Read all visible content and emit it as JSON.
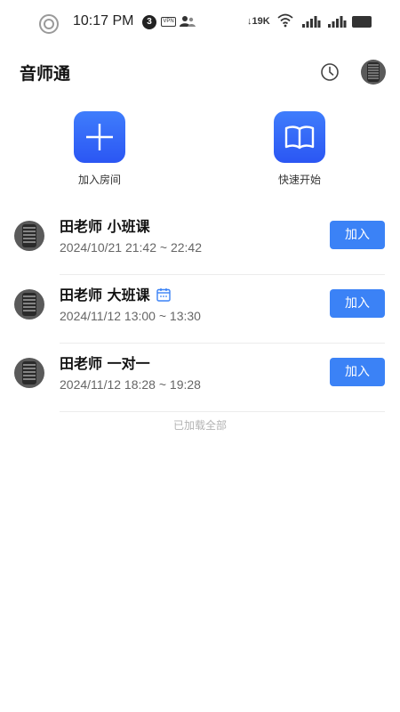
{
  "status_bar": {
    "time": "10:17 PM",
    "badge": "3",
    "vpn": "VPN",
    "net_speed": "19K",
    "icons": [
      "ring-icon",
      "vpn-icon",
      "person-icon",
      "wifi-icon",
      "signal-icon",
      "signal-icon",
      "battery-icon"
    ]
  },
  "header": {
    "title": "音师通",
    "history_icon": "clock-icon",
    "avatar": "avatar"
  },
  "actions": [
    {
      "label": "加入房间",
      "icon": "plus-icon"
    },
    {
      "label": "快速开始",
      "icon": "book-icon"
    }
  ],
  "colors": {
    "accent": "#3b82f6",
    "tile_gradient_top": "#3f7dfc",
    "tile_gradient_bottom": "#2b56f3"
  },
  "rooms": [
    {
      "title": "田老师 小班课",
      "time": "2024/10/21 21:42 ~ 22:42",
      "button": "加入",
      "has_calendar_icon": false
    },
    {
      "title": "田老师 大班课",
      "time": "2024/11/12 13:00 ~ 13:30",
      "button": "加入",
      "has_calendar_icon": true
    },
    {
      "title": "田老师 一对一",
      "time": "2024/11/12 18:28 ~ 19:28",
      "button": "加入",
      "has_calendar_icon": false
    }
  ],
  "footer_text": "已加载全部"
}
